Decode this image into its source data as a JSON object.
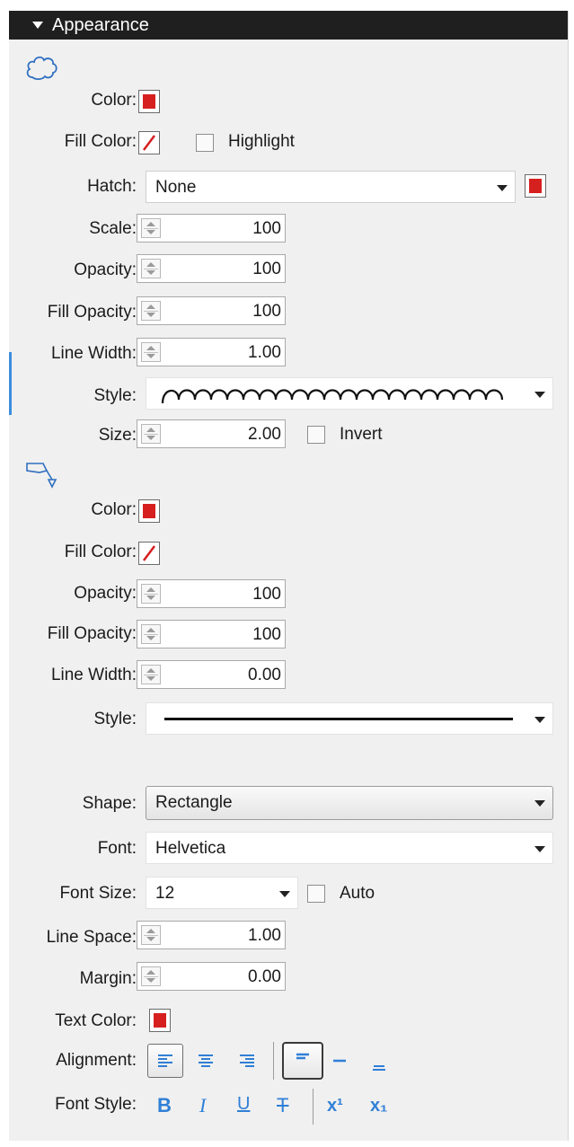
{
  "header": {
    "title": "Appearance"
  },
  "colors": {
    "red": "#d61f1f",
    "accent": "#2f7fd6",
    "header_bg": "#1f1f1f"
  },
  "section1": {
    "icon": "cloud-shape-icon",
    "color_label": "Color:",
    "fill_color_label": "Fill Color:",
    "highlight_label": "Highlight",
    "hatch_label": "Hatch:",
    "hatch_value": "None",
    "scale_label": "Scale:",
    "scale_value": "100",
    "opacity_label": "Opacity:",
    "opacity_value": "100",
    "fill_opacity_label": "Fill Opacity:",
    "fill_opacity_value": "100",
    "line_width_label": "Line Width:",
    "line_width_value": "1.00",
    "style_label": "Style:",
    "size_label": "Size:",
    "size_value": "2.00",
    "invert_label": "Invert"
  },
  "section2": {
    "icon": "callout-leader-icon",
    "color_label": "Color:",
    "fill_color_label": "Fill Color:",
    "opacity_label": "Opacity:",
    "opacity_value": "100",
    "fill_opacity_label": "Fill Opacity:",
    "fill_opacity_value": "100",
    "line_width_label": "Line Width:",
    "line_width_value": "0.00",
    "style_label": "Style:"
  },
  "text": {
    "shape_label": "Shape:",
    "shape_value": "Rectangle",
    "font_label": "Font:",
    "font_value": "Helvetica",
    "font_size_label": "Font Size:",
    "font_size_value": "12",
    "auto_label": "Auto",
    "line_space_label": "Line Space:",
    "line_space_value": "1.00",
    "margin_label": "Margin:",
    "margin_value": "0.00",
    "text_color_label": "Text Color:",
    "alignment_label": "Alignment:",
    "font_style_label": "Font Style:",
    "bold_glyph": "B",
    "italic_glyph": "I",
    "underline_glyph": "U",
    "strike_glyph": "T",
    "superscript_glyph": "x¹",
    "subscript_glyph": "x₁"
  }
}
